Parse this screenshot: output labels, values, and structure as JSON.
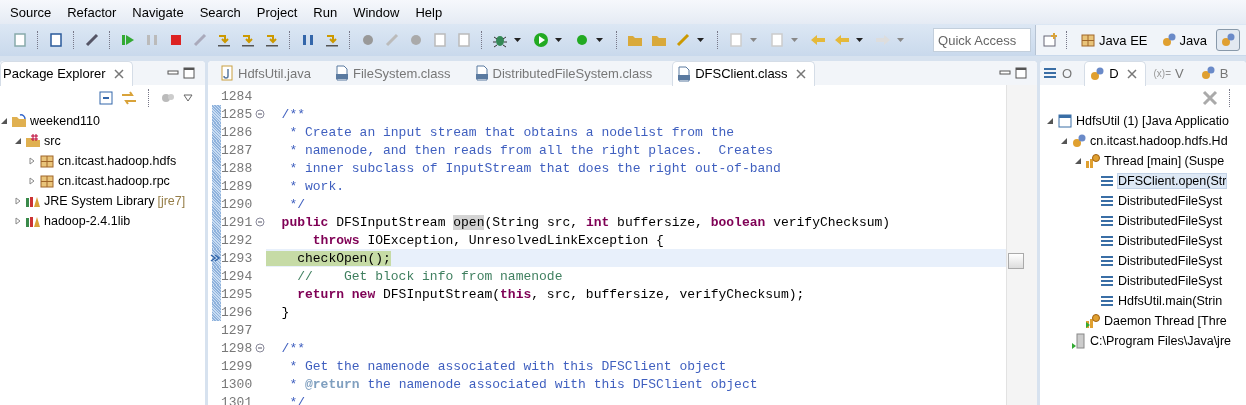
{
  "menu": [
    "Source",
    "Refactor",
    "Navigate",
    "Search",
    "Project",
    "Run",
    "Window",
    "Help"
  ],
  "quick_access": {
    "placeholder": "Quick Access"
  },
  "perspectives": [
    {
      "label": "Java EE",
      "kind": "javaee",
      "selected": false
    },
    {
      "label": "Java",
      "kind": "java",
      "selected": false
    },
    {
      "kind": "debug",
      "selected": true
    }
  ],
  "package_explorer": {
    "title": "Package Explorer",
    "tree": [
      {
        "label": "weekend110",
        "kind": "project",
        "expanded": true,
        "children": [
          {
            "label": "src",
            "kind": "source-folder",
            "expanded": true,
            "children": [
              {
                "label": "cn.itcast.hadoop.hdfs",
                "kind": "package",
                "expanded": false
              },
              {
                "label": "cn.itcast.hadoop.rpc",
                "kind": "package",
                "expanded": false
              }
            ]
          },
          {
            "label": "JRE System Library",
            "decoration": "[jre7]",
            "kind": "library",
            "expanded": false
          },
          {
            "label": "hadoop-2.4.1lib",
            "kind": "library",
            "expanded": false
          }
        ]
      }
    ]
  },
  "editor": {
    "tabs": [
      {
        "label": "HdfsUtil.java",
        "kind": "java",
        "selected": false
      },
      {
        "label": "FileSystem.class",
        "kind": "class",
        "selected": false
      },
      {
        "label": "DistributedFileSystem.class",
        "kind": "class",
        "selected": false
      },
      {
        "label": "DFSClient.class",
        "kind": "class",
        "selected": true
      }
    ],
    "lines": [
      {
        "number": "1284",
        "foldable": false,
        "range": false,
        "current": false
      },
      {
        "number": "1285",
        "foldable": true,
        "range": true,
        "current": false,
        "segments": [
          {
            "kind": "javadoc",
            "text": "  /**"
          }
        ]
      },
      {
        "number": "1286",
        "foldable": false,
        "range": true,
        "current": false,
        "segments": [
          {
            "kind": "javadoc",
            "text": "   * Create an input stream that obtains a nodelist from the"
          }
        ]
      },
      {
        "number": "1287",
        "foldable": false,
        "range": true,
        "current": false,
        "segments": [
          {
            "kind": "javadoc",
            "text": "   * namenode, and then reads from all the right places.  Creates"
          }
        ]
      },
      {
        "number": "1288",
        "foldable": false,
        "range": true,
        "current": false,
        "segments": [
          {
            "kind": "javadoc",
            "text": "   * inner subclass of InputStream that does the right out-of-band"
          }
        ]
      },
      {
        "number": "1289",
        "foldable": false,
        "range": true,
        "current": false,
        "segments": [
          {
            "kind": "javadoc",
            "text": "   * work."
          }
        ]
      },
      {
        "number": "1290",
        "foldable": false,
        "range": true,
        "current": false,
        "segments": [
          {
            "kind": "javadoc",
            "text": "   */"
          }
        ]
      },
      {
        "number": "1291",
        "foldable": true,
        "range": true,
        "current": false,
        "segments": [
          {
            "kind": "keyword",
            "text": "  public"
          },
          {
            "kind": "code",
            "text": " DFSInputStream "
          },
          {
            "kind": "occurrence",
            "text": "open"
          },
          {
            "kind": "code",
            "text": "(String src, "
          },
          {
            "kind": "keyword",
            "text": "int"
          },
          {
            "kind": "code",
            "text": " buffersize, "
          },
          {
            "kind": "keyword",
            "text": "boolean"
          },
          {
            "kind": "code",
            "text": " verifyChecksum)"
          }
        ]
      },
      {
        "number": "1292",
        "foldable": false,
        "range": true,
        "current": false,
        "segments": [
          {
            "kind": "keyword",
            "text": "      throws"
          },
          {
            "kind": "code",
            "text": " IOException, UnresolvedLinkException {"
          }
        ]
      },
      {
        "number": "1293",
        "foldable": false,
        "range": true,
        "current": true,
        "segments": [
          {
            "kind": "executing",
            "text": "    checkOpen();"
          }
        ]
      },
      {
        "number": "1294",
        "foldable": false,
        "range": true,
        "current": false,
        "segments": [
          {
            "kind": "comment",
            "text": "    //    Get block info from namenode"
          }
        ]
      },
      {
        "number": "1295",
        "foldable": false,
        "range": true,
        "current": false,
        "segments": [
          {
            "kind": "keyword",
            "text": "    return new"
          },
          {
            "kind": "code",
            "text": " DFSInputStream("
          },
          {
            "kind": "keyword",
            "text": "this"
          },
          {
            "kind": "code",
            "text": ", src, buffersize, verifyChecksum);"
          }
        ]
      },
      {
        "number": "1296",
        "foldable": false,
        "range": true,
        "current": false,
        "segments": [
          {
            "kind": "code",
            "text": "  }"
          }
        ]
      },
      {
        "number": "1297",
        "foldable": false,
        "range": false,
        "current": false
      },
      {
        "number": "1298",
        "foldable": true,
        "range": false,
        "current": false,
        "segments": [
          {
            "kind": "javadoc",
            "text": "  /**"
          }
        ]
      },
      {
        "number": "1299",
        "foldable": false,
        "range": false,
        "current": false,
        "segments": [
          {
            "kind": "javadoc",
            "text": "   * Get the namenode associated with this DFSClient object"
          }
        ]
      },
      {
        "number": "1300",
        "foldable": false,
        "range": false,
        "current": false,
        "segments": [
          {
            "kind": "javadoc",
            "text": "   * "
          },
          {
            "kind": "javadoc-tag",
            "text": "@return"
          },
          {
            "kind": "javadoc",
            "text": " the namenode associated with this DFSClient object"
          }
        ]
      },
      {
        "number": "1301",
        "foldable": false,
        "range": false,
        "current": false,
        "segments": [
          {
            "kind": "javadoc",
            "text": "   */"
          }
        ]
      }
    ]
  },
  "debug_view": {
    "tabs": [
      {
        "label": "O",
        "kind": "outline",
        "selected": false
      },
      {
        "label": "D",
        "kind": "debug",
        "selected": true
      },
      {
        "label": "V",
        "icon_text": "(x)=",
        "kind": "variables",
        "selected": false
      },
      {
        "label": "B",
        "kind": "breakpoints",
        "selected": false
      }
    ],
    "tree": [
      {
        "label": "HdfsUtil (1) [Java Applicatio",
        "kind": "launch",
        "expanded": true,
        "selected": false,
        "children": [
          {
            "label": "cn.itcast.hadoop.hdfs.Hd",
            "kind": "vm",
            "expanded": true,
            "selected": false,
            "children": [
              {
                "label": "Thread [main] (Suspe",
                "kind": "thread",
                "expanded": true,
                "selected": false,
                "children": [
                  {
                    "label": "DFSClient.open(Str",
                    "kind": "frame",
                    "selected": true
                  },
                  {
                    "label": "DistributedFileSyst",
                    "kind": "frame",
                    "selected": false
                  },
                  {
                    "label": "DistributedFileSyst",
                    "kind": "frame",
                    "selected": false
                  },
                  {
                    "label": "DistributedFileSyst",
                    "kind": "frame",
                    "selected": false
                  },
                  {
                    "label": "DistributedFileSyst",
                    "kind": "frame",
                    "selected": false
                  },
                  {
                    "label": "DistributedFileSyst",
                    "kind": "frame",
                    "selected": false
                  },
                  {
                    "label": "HdfsUtil.main(Strin",
                    "kind": "frame",
                    "selected": false
                  }
                ]
              },
              {
                "label": "Daemon Thread [Thre",
                "kind": "daemon",
                "selected": false
              }
            ]
          },
          {
            "label": "C:\\Program Files\\Java\\jre",
            "kind": "process",
            "selected": false
          }
        ]
      }
    ]
  }
}
